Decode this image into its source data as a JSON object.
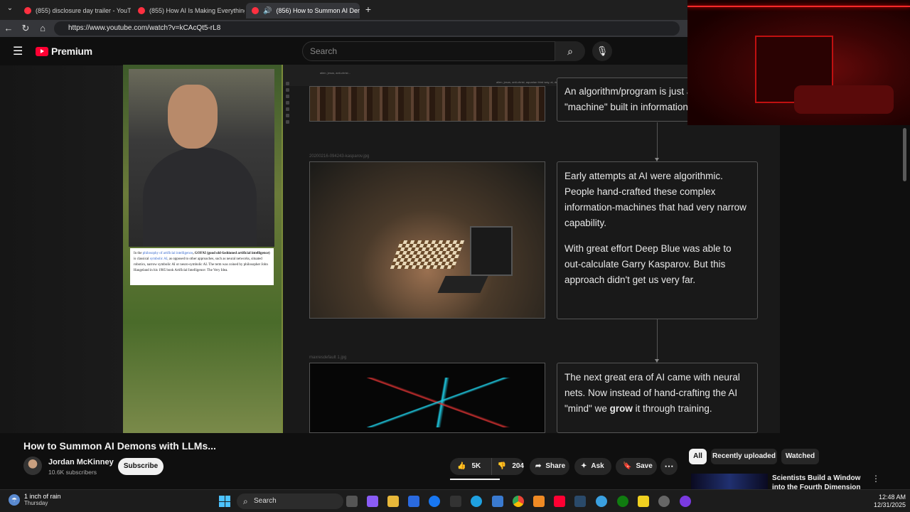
{
  "browser": {
    "tabs": [
      {
        "label": "(855) disclosure day trailer - YouTu",
        "active": false
      },
      {
        "label": "(855) How AI Is Making Everything",
        "active": false
      },
      {
        "label": "(856) How to Summon AI Dem",
        "active": true
      }
    ],
    "new_tab": "+",
    "url": "https://www.youtube.com/watch?v=kCAcQt5-rL8"
  },
  "youtube": {
    "logo_text": "Premium",
    "search_placeholder": "Search",
    "brand_color": "#ff0033"
  },
  "video_content": {
    "wiki_snippet": {
      "pre": "In the ",
      "link1": "philosophy of artificial intelligence",
      "bold": ", GOFAI (good old-fashioned artificial intelligence)",
      "mid": " is classical ",
      "link2": "symbolic AI",
      "rest": ", as opposed to other approaches, such as neural networks, situated robotics, narrow symbolic AI or neuro-symbolic AI. The term was coined by philosopher John Haugeland in his 1985 book Artificial Intelligence: The Very Idea."
    },
    "slide_top_left": "alien, jesus, anti-christ...",
    "slide_top_right": "alien, jesus, anti-christ, aquarian third way, ai, demons",
    "file1": "20200216-094243-kasparov.jpg",
    "file2": "maxresdefault 1.jpg",
    "box1": {
      "text1": "An algorithm/program is just a",
      "text2": "\"machine\" built in information."
    },
    "box2": {
      "p1": "Early attempts at AI were algorithmic. People hand-crafted these complex information-machines that had very narrow capability.",
      "p2": "With great effort Deep Blue was able to out-calculate Garry Kasparov. But this approach didn't get us very far."
    },
    "box3": {
      "pre": "The next great era of AI came with neural nets. Now instead of hand-crafting the AI \"mind\" we ",
      "bold": "grow",
      "post": " it through training."
    }
  },
  "video_info": {
    "title": "How to Summon AI Demons with LLMs...",
    "channel": "Jordan McKinney",
    "subscribers": "10.6K subscribers",
    "subscribe_label": "Subscribe",
    "likes": "5K",
    "dislikes": "204",
    "share_label": "Share",
    "ask_label": "Ask",
    "save_label": "Save"
  },
  "recommendations": {
    "chips": [
      "All",
      "Recently uploaded",
      "Watched"
    ],
    "item_title": "Scientists Build a Window into the Fourth Dimension"
  },
  "taskbar": {
    "weather_title": "1 inch of rain",
    "weather_sub": "Thursday",
    "search_label": "Search",
    "time": "12:48 AM",
    "date": "12/31/2025"
  }
}
